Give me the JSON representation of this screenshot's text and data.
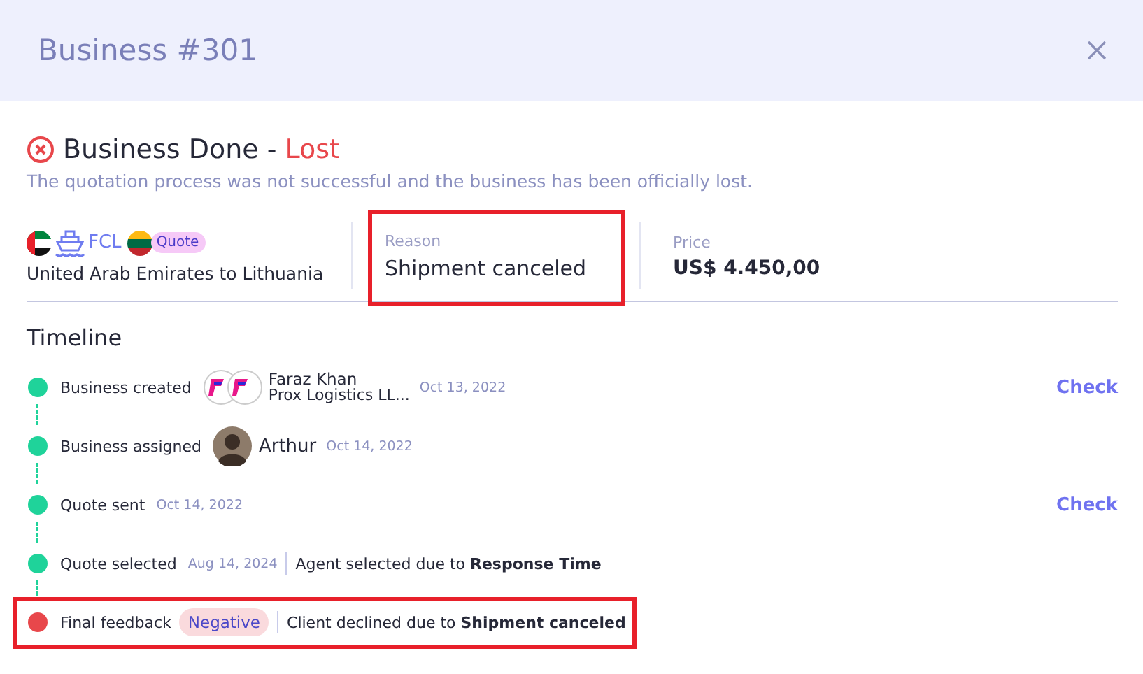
{
  "window": {
    "title": "Business #301"
  },
  "status": {
    "label": "Business Done - ",
    "outcome": "Lost",
    "description": "The quotation process was not successful and the business has been officially lost."
  },
  "shipment": {
    "mode": "FCL",
    "tag": "Quote",
    "route": "United Arab Emirates to Lithuania"
  },
  "reason": {
    "label": "Reason",
    "value": "Shipment canceled",
    "highlighted": true
  },
  "price": {
    "label": "Price",
    "value": "US$ 4.450,00"
  },
  "timeline": {
    "title": "Timeline",
    "events": [
      {
        "label": "Business created",
        "color": "#1fd39a",
        "kind": "company",
        "name": "Faraz Khan",
        "company": "Prox Logistics LL...",
        "date": "Oct 13, 2022",
        "action": "Check",
        "highlighted": false
      },
      {
        "label": "Business assigned",
        "color": "#1fd39a",
        "kind": "person",
        "name": "Arthur",
        "date": "Oct 14, 2022",
        "highlighted": false
      },
      {
        "label": "Quote sent",
        "color": "#1fd39a",
        "kind": "plain",
        "date": "Oct 14, 2022",
        "action": "Check",
        "highlighted": false
      },
      {
        "label": "Quote selected",
        "color": "#1fd39a",
        "kind": "plain",
        "date": "Aug 14, 2024",
        "note": "Agent selected due to **Response Time**",
        "highlighted": false
      },
      {
        "label": "Final feedback",
        "color": "#e8474b",
        "kind": "feedback",
        "tag": "Negative",
        "note": "Client declined due to **Shipment canceled**",
        "highlighted": true
      }
    ]
  }
}
